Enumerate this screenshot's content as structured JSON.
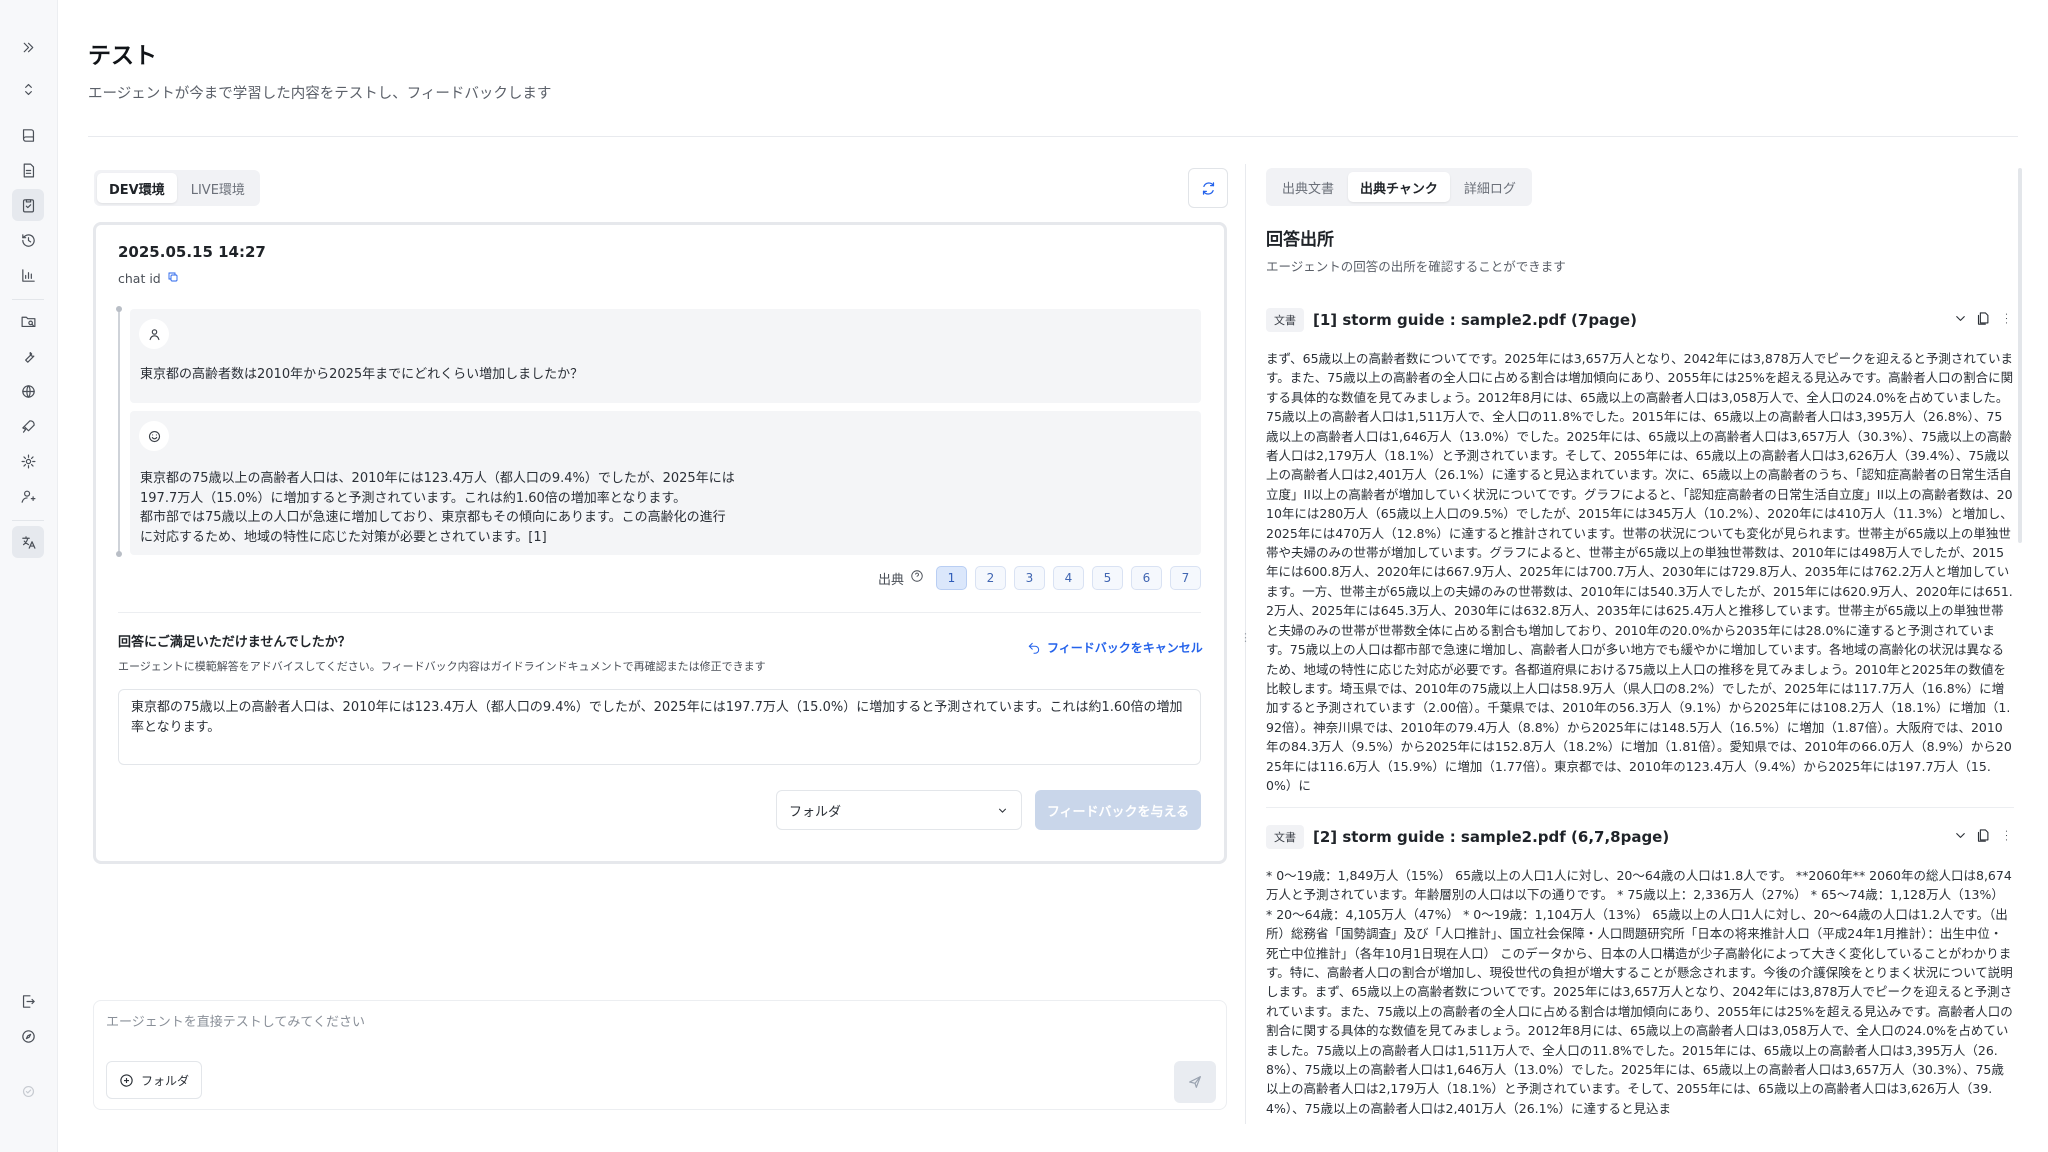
{
  "sidebar": {
    "items": [
      {
        "name": "expand-icon"
      },
      {
        "name": "switch-icon"
      },
      {
        "name": "book-icon"
      },
      {
        "name": "document-icon"
      },
      {
        "name": "clipboard-check-icon",
        "active": true
      },
      {
        "name": "history-icon"
      },
      {
        "name": "bar-chart-icon"
      },
      {
        "name": "folder-search-icon"
      },
      {
        "name": "wrench-icon"
      },
      {
        "name": "globe-icon"
      },
      {
        "name": "rocket-icon"
      },
      {
        "name": "gear-icon"
      },
      {
        "name": "user-settings-icon"
      },
      {
        "name": "translate-icon",
        "active": true
      },
      {
        "name": "logout-icon"
      },
      {
        "name": "compass-icon"
      },
      {
        "name": "status-icon"
      }
    ]
  },
  "header": {
    "title": "テスト",
    "subtitle": "エージェントが今まで学習した内容をテストし、フィードバックします"
  },
  "env_tabs": [
    {
      "label": "DEV環境",
      "active": true
    },
    {
      "label": "LIVE環境",
      "active": false
    }
  ],
  "chat": {
    "timestamp": "2025.05.15 14:27",
    "chat_id_label": "chat id",
    "user_message": "東京都の高齢者数は2010年から2025年までにどれくらい増加しましたか？",
    "ai_message_lines": [
      "東京都の75歳以上の高齢者人口は、2010年には123.4万人（都人口の9.4%）でしたが、2025年には",
      "197.7万人（15.0%）に増加すると予測されています。これは約1.60倍の増加率となります。",
      "都市部では75歳以上の人口が急速に増加しており、東京都もその傾向にあります。この高齢化の進行",
      "に対応するため、地域の特性に応じた対策が必要とされています。[1]"
    ],
    "sources_label": "出典",
    "source_chips": [
      "1",
      "2",
      "3",
      "4",
      "5",
      "6",
      "7"
    ],
    "active_source": "1"
  },
  "feedback": {
    "title": "回答にご満足いただけませんでしたか？",
    "description": "エージェントに模範解答をアドバイスしてください。フィードバック内容はガイドラインドキュメントで再確認または修正できます",
    "cancel_label": "フィードバックをキャンセル",
    "text": "東京都の75歳以上の高齢者人口は、2010年には123.4万人（都人口の9.4%）でしたが、2025年には197.7万人（15.0%）に増加すると予測されています。これは約1.60倍の増加率となります。",
    "folder_select": "フォルダ",
    "submit_label": "フィードバックを与える"
  },
  "chat_input": {
    "placeholder": "エージェントを直接テストしてみてください",
    "folder_label": "フォルダ"
  },
  "right_panel": {
    "tabs": [
      {
        "label": "出典文書",
        "active": false
      },
      {
        "label": "出典チャンク",
        "active": true
      },
      {
        "label": "詳細ログ",
        "active": false
      }
    ],
    "title": "回答出所",
    "subtitle": "エージェントの回答の出所を確認することができます",
    "docs": [
      {
        "badge": "文書",
        "title": "[1] storm guide : sample2.pdf (7page)",
        "body": "まず、65歳以上の高齢者数についてです。2025年には3,657万人となり、2042年には3,878万人でピークを迎えると予測されています。また、75歳以上の高齢者の全人口に占める割合は増加傾向にあり、2055年には25%を超える見込みです。高齢者人口の割合に関する具体的な数値を見てみましょう。2012年8月には、65歳以上の高齢者人口は3,058万人で、全人口の24.0%を占めていました。75歳以上の高齢者人口は1,511万人で、全人口の11.8%でした。2015年には、65歳以上の高齢者人口は3,395万人（26.8%）、75歳以上の高齢者人口は1,646万人（13.0%）でした。2025年には、65歳以上の高齢者人口は3,657万人（30.3%）、75歳以上の高齢者人口は2,179万人（18.1%）と予測されています。そして、2055年には、65歳以上の高齢者人口は3,626万人（39.4%）、75歳以上の高齢者人口は2,401万人（26.1%）に達すると見込まれています。次に、65歳以上の高齢者のうち、「認知症高齢者の日常生活自立度」II以上の高齢者が増加していく状況についてです。グラフによると、「認知症高齢者の日常生活自立度」II以上の高齢者数は、2010年には280万人（65歳以上人口の9.5%）でしたが、2015年には345万人（10.2%）、2020年には410万人（11.3%）と増加し、2025年には470万人（12.8%）に達すると推計されています。世帯の状況についても変化が見られます。世帯主が65歳以上の単独世帯や夫婦のみの世帯が増加しています。グラフによると、世帯主が65歳以上の単独世帯数は、2010年には498万人でしたが、2015年には600.8万人、2020年には667.9万人、2025年には700.7万人、2030年には729.8万人、2035年には762.2万人と増加しています。一方、世帯主が65歳以上の夫婦のみの世帯数は、2010年には540.3万人でしたが、2015年には620.9万人、2020年には651.2万人、2025年には645.3万人、2030年には632.8万人、2035年には625.4万人と推移しています。世帯主が65歳以上の単独世帯と夫婦のみの世帯が世帯数全体に占める割合も増加しており、2010年の20.0%から2035年には28.0%に達すると予測されています。75歳以上の人口は都市部で急速に増加し、高齢者人口が多い地方でも緩やかに増加しています。各地域の高齢化の状況は異なるため、地域の特性に応じた対応が必要です。各都道府県における75歳以上人口の推移を見てみましょう。2010年と2025年の数値を比較します。埼玉県では、2010年の75歳以上人口は58.9万人（県人口の8.2%）でしたが、2025年には117.7万人（16.8%）に増加すると予測されています（2.00倍）。千葉県では、2010年の56.3万人（9.1%）から2025年には108.2万人（18.1%）に増加（1.92倍）。神奈川県では、2010年の79.4万人（8.8%）から2025年には148.5万人（16.5%）に増加（1.87倍）。大阪府では、2010年の84.3万人（9.5%）から2025年には152.8万人（18.2%）に増加（1.81倍）。愛知県では、2010年の66.0万人（8.9%）から2025年には116.6万人（15.9%）に増加（1.77倍）。東京都では、2010年の123.4万人（9.4%）から2025年には197.7万人（15.0%）に"
      },
      {
        "badge": "文書",
        "title": "[2] storm guide : sample2.pdf (6,7,8page)",
        "body": "* 0～19歳：1,849万人（15%） 65歳以上の人口1人に対し、20～64歳の人口は1.8人です。 **2060年** 2060年の総人口は8,674万人と予測されています。年齢層別の人口は以下の通りです。 * 75歳以上：2,336万人（27%） * 65～74歳：1,128万人（13%） * 20～64歳：4,105万人（47%） * 0～19歳：1,104万人（13%） 65歳以上の人口1人に対し、20～64歳の人口は1.2人です。（出所）総務省「国勢調査」及び「人口推計」、国立社会保障・人口問題研究所「日本の将来推計人口（平成24年1月推計）：出生中位・死亡中位推計」（各年10月1日現在人口） このデータから、日本の人口構造が少子高齢化によって大きく変化していることがわかります。特に、高齢者人口の割合が増加し、現役世代の負担が増大することが懸念されます。今後の介護保険をとりまく状況について説明します。まず、65歳以上の高齢者数についてです。2025年には3,657万人となり、2042年には3,878万人でピークを迎えると予測されています。また、75歳以上の高齢者の全人口に占める割合は増加傾向にあり、2055年には25%を超える見込みです。高齢者人口の割合に関する具体的な数値を見てみましょう。2012年8月には、65歳以上の高齢者人口は3,058万人で、全人口の24.0%を占めていました。75歳以上の高齢者人口は1,511万人で、全人口の11.8%でした。2015年には、65歳以上の高齢者人口は3,395万人（26.8%）、75歳以上の高齢者人口は1,646万人（13.0%）でした。2025年には、65歳以上の高齢者人口は3,657万人（30.3%）、75歳以上の高齢者人口は2,179万人（18.1%）と予測されています。そして、2055年には、65歳以上の高齢者人口は3,626万人（39.4%）、75歳以上の高齢者人口は2,401万人（26.1%）に達すると見込ま"
      }
    ]
  },
  "colors": {
    "accent": "#2563eb",
    "chip_active_bg": "#dbe7fb",
    "button_disabled": "#c9d6ea"
  }
}
